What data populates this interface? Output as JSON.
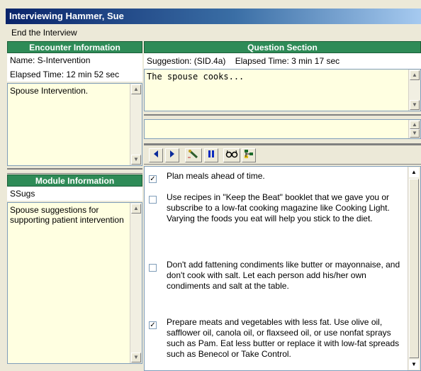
{
  "window": {
    "title": "Interviewing Hammer, Sue"
  },
  "menu": {
    "end_interview": "End the Interview"
  },
  "encounter": {
    "header": "Encounter Information",
    "name": "Name: S-Intervention",
    "elapsed": "Elapsed Time: 12 min 52 sec",
    "notes": "Spouse Intervention."
  },
  "module": {
    "header": "Module Information",
    "name": "SSugs",
    "notes": "Spouse suggestions for supporting patient intervention"
  },
  "question": {
    "header": "Question Section",
    "suggestion": "Suggestion: (SID.4a)",
    "elapsed": "Elapsed Time: 3 min 17 sec",
    "text": "The spouse cooks...",
    "answer": ""
  },
  "toolbar": {
    "buttons": [
      "back-icon",
      "forward-icon",
      "edit-pen-icon",
      "pause-icon",
      "glasses-icon",
      "tree-icon"
    ]
  },
  "items": [
    {
      "checked": true,
      "text": "Plan meals ahead of time."
    },
    {
      "checked": false,
      "text": "Use recipes in \"Keep the Beat\" booklet that we gave you or subscribe to a low-fat cooking magazine like Cooking Light. Varying the foods you eat will help you stick to the diet."
    },
    {
      "checked": false,
      "text": "Don't add fattening condiments like butter or mayonnaise, and don't cook with salt. Let each person add his/her own condiments and salt at the table."
    },
    {
      "checked": true,
      "text": "Prepare meats and vegetables with less fat. Use olive oil, safflower oil, canola oil, or flaxseed oil, or use nonfat sprays such as Pam. Eat less butter or replace it with low-fat spreads such as Benecol or Take Control."
    }
  ]
}
